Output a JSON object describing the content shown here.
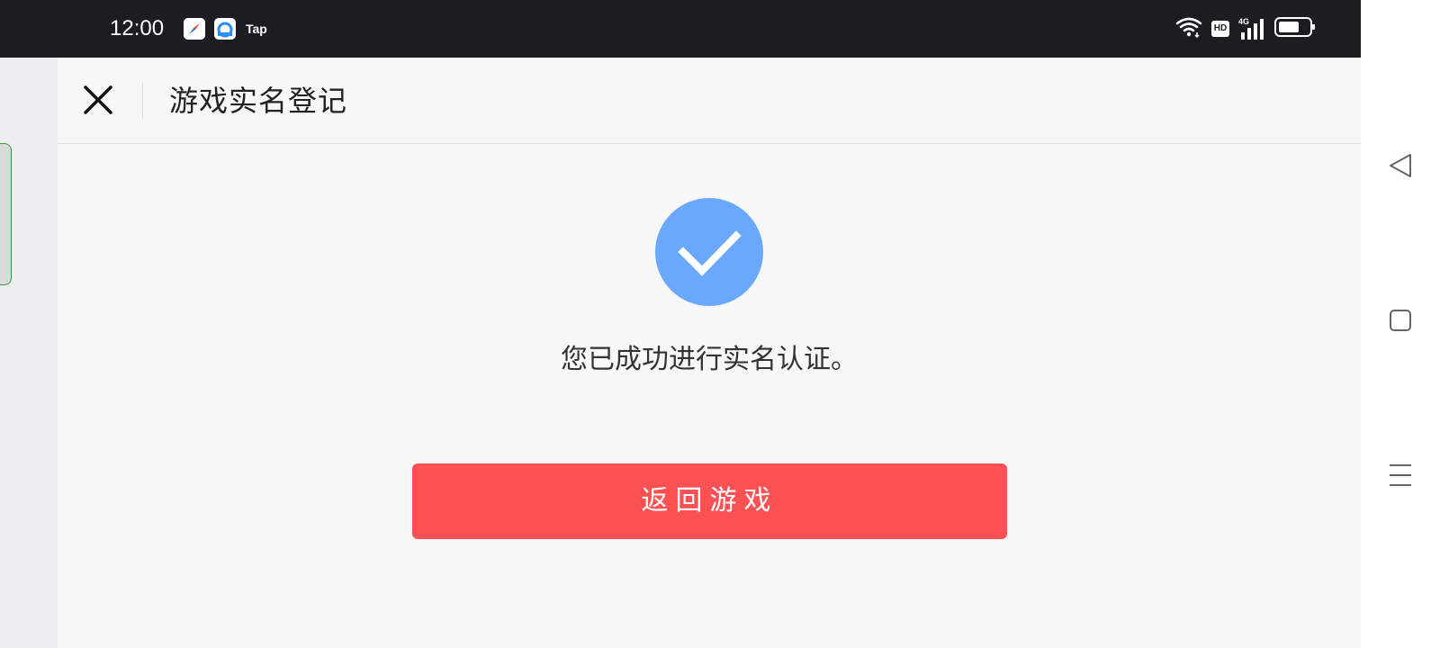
{
  "status_bar": {
    "time": "12:00",
    "apps": [
      "compass-icon",
      "cloud-icon",
      "tap-icon"
    ],
    "tap_label": "Tap",
    "hd_label": "HD",
    "network_label": "4G",
    "background_color": "#1b1d21"
  },
  "header": {
    "title": "游戏实名登记",
    "close_icon": "close-icon"
  },
  "content": {
    "success_icon": "check-circle-icon",
    "success_color": "#6aa8fe",
    "message": "您已成功进行实名认证。"
  },
  "actions": {
    "return_label": "返回游戏",
    "button_color": "#fc5153"
  },
  "nav_bar": {
    "items": [
      "back-icon",
      "home-icon",
      "menu-icon"
    ]
  }
}
